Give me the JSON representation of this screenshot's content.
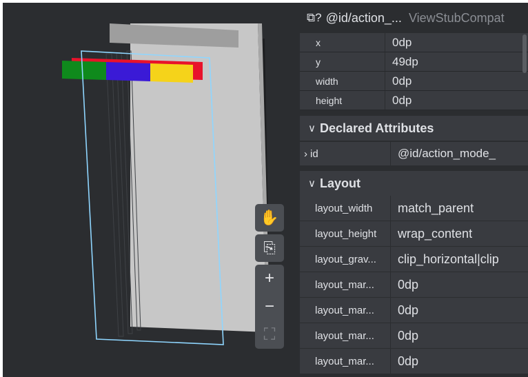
{
  "title": {
    "icon": "view-stub-icon",
    "view_id": "@id/action_...",
    "view_class": "ViewStubCompat"
  },
  "basic_attributes": [
    {
      "key": "x",
      "value": "0dp"
    },
    {
      "key": "y",
      "value": "49dp"
    },
    {
      "key": "width",
      "value": "0dp"
    },
    {
      "key": "height",
      "value": "0dp"
    }
  ],
  "declared_section": {
    "label": "Declared Attributes",
    "icon": "chevron-down-icon"
  },
  "declared_attributes": [
    {
      "key": "id",
      "value": "@id/action_mode_",
      "icon": "chevron-right-icon"
    }
  ],
  "layout_section": {
    "label": "Layout",
    "icon": "chevron-down-icon"
  },
  "layout_attributes": [
    {
      "key": "layout_width",
      "value": "match_parent"
    },
    {
      "key": "layout_height",
      "value": "wrap_content"
    },
    {
      "key": "layout_grav...",
      "value": "clip_horizontal|clip"
    },
    {
      "key": "layout_mar...",
      "value": "0dp"
    },
    {
      "key": "layout_mar...",
      "value": "0dp"
    },
    {
      "key": "layout_mar...",
      "value": "0dp"
    },
    {
      "key": "layout_mar...",
      "value": "0dp"
    }
  ],
  "view_toolbar": [
    "pan-hand-icon",
    "export-icon",
    "zoom-in-icon",
    "zoom-out-icon",
    "fit-screen-icon"
  ],
  "colors": {
    "background": "#2b2d30",
    "row": "#393b40",
    "text": "#dfe1e5",
    "muted": "#8b8e94",
    "layer_red": "#e8132b",
    "layer_green": "#0f8a1c",
    "layer_blue": "#3a1ad6",
    "layer_yellow": "#f5d31a",
    "selection": "#8fd6ff"
  }
}
